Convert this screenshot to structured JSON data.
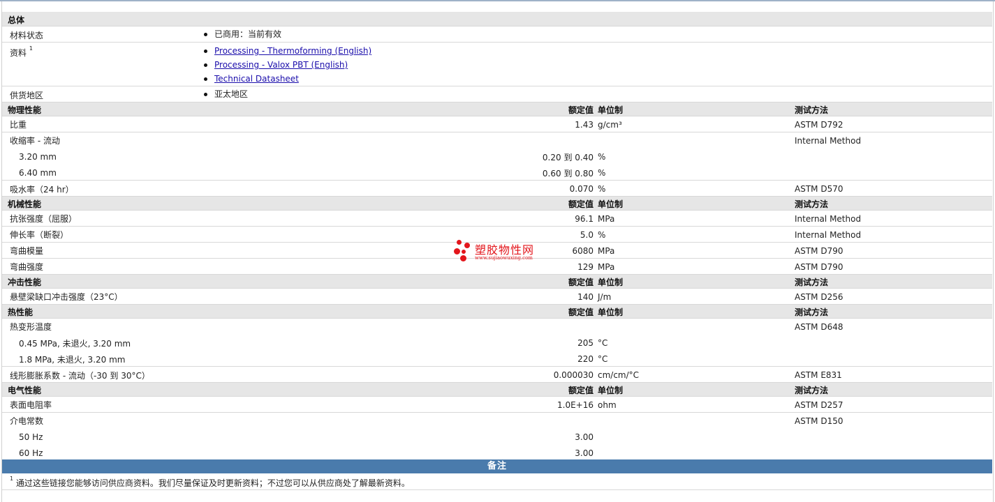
{
  "general": {
    "title": "总体",
    "status_label": "材料状态",
    "status_value": "已商用：当前有效",
    "docs_label": "资料",
    "docs_sup": "1",
    "docs": [
      "Processing - Thermoforming (English)",
      "Processing - Valox PBT (English)",
      "Technical Datasheet"
    ],
    "supply_label": "供货地区",
    "supply_value": "亚太地区"
  },
  "headers": {
    "rated": "额定值",
    "unit": "单位制",
    "method": "测试方法"
  },
  "physical": {
    "title": "物理性能",
    "sg_label": "比重",
    "sg_value": "1.43",
    "sg_unit": "g/cm³",
    "sg_method": "ASTM D792",
    "shrink_label": "收缩率  - 流动",
    "shrink_method": "Internal Method",
    "s1_label": "3.20 mm",
    "s1_value": "0.20 到  0.40",
    "s1_unit": "%",
    "s2_label": "6.40 mm",
    "s2_value": "0.60 到  0.80",
    "s2_unit": "%",
    "wa_label": "吸水率（24 hr）",
    "wa_value": "0.070",
    "wa_unit": "%",
    "wa_method": "ASTM D570"
  },
  "mechanical": {
    "title": "机械性能",
    "ts_label": "抗张强度（屈服）",
    "ts_value": "96.1",
    "ts_unit": "MPa",
    "ts_method": "Internal Method",
    "el_label": "伸长率（断裂）",
    "el_value": "5.0",
    "el_unit": "%",
    "el_method": "Internal Method",
    "fm_label": "弯曲模量",
    "fm_value": "6080",
    "fm_unit": "MPa",
    "fm_method": "ASTM D790",
    "fs_label": "弯曲强度",
    "fs_value": "129",
    "fs_unit": "MPa",
    "fs_method": "ASTM D790"
  },
  "impact": {
    "title": "冲击性能",
    "iz_label": "悬壁梁缺口冲击强度（23°C）",
    "iz_value": "140",
    "iz_unit": "J/m",
    "iz_method": "ASTM D256"
  },
  "thermal": {
    "title": "热性能",
    "hdt_label": "热变形温度",
    "hdt_method": "ASTM D648",
    "h1_label": "0.45 MPa, 未退火, 3.20 mm",
    "h1_value": "205",
    "h1_unit": "°C",
    "h2_label": "1.8 MPa, 未退火, 3.20 mm",
    "h2_value": "220",
    "h2_unit": "°C",
    "cte_label": "线形膨胀系数  - 流动（-30 到  30°C）",
    "cte_value": "0.000030",
    "cte_unit": "cm/cm/°C",
    "cte_method": "ASTM E831"
  },
  "electrical": {
    "title": "电气性能",
    "sr_label": "表面电阻率",
    "sr_value": "1.0E+16",
    "sr_unit": "ohm",
    "sr_method": "ASTM D257",
    "dc_label": "介电常数",
    "dc_method": "ASTM D150",
    "d1_label": "50 Hz",
    "d1_value": "3.00",
    "d2_label": "60 Hz",
    "d2_value": "3.00"
  },
  "notes": {
    "title": "备注",
    "sup": "1",
    "text": "通过这些链接您能够访问供应商资料。我们尽量保证及时更新资料；不过您可以从供应商处了解最新资料。"
  },
  "watermark": {
    "title": "塑胶物性网",
    "url": "www.sujiaowuxing.com",
    "color": "#e3151b"
  }
}
